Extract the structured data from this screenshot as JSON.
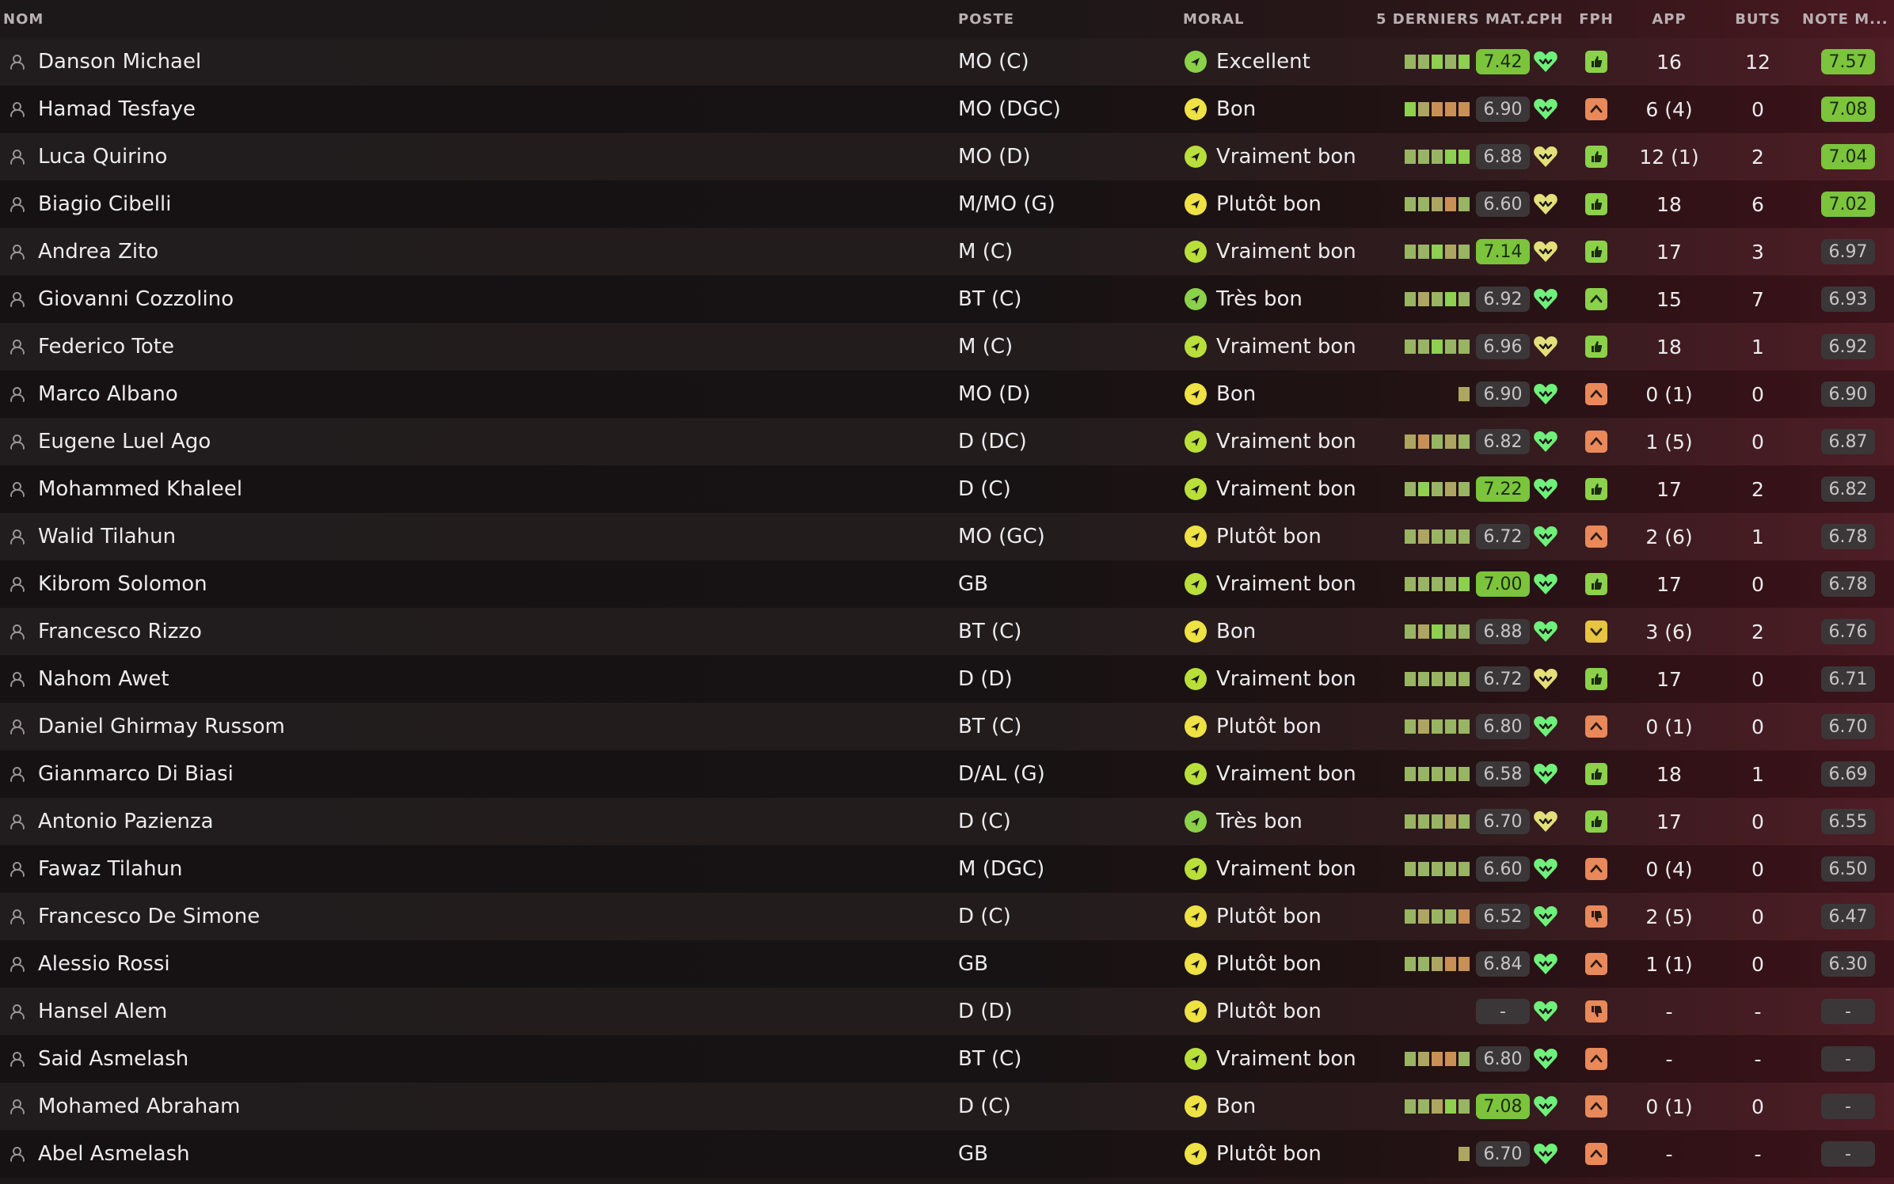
{
  "headers": {
    "nom": "NOM",
    "poste": "POSTE",
    "moral": "MORAL",
    "forme": "5 DERNIERS MAT...",
    "cph": "CPH",
    "fph": "FPH",
    "app": "APP",
    "buts": "BUTS",
    "note": "NOTE M..."
  },
  "icons": {
    "player": "person-icon",
    "cph": "heart-icon",
    "fph_up": "chevron-up-icon",
    "fph_down": "chevron-down-icon",
    "fph_thumb": "thumb-up-icon",
    "fph_thumbdown": "thumb-down-icon",
    "morale": "arrow-icon"
  },
  "colors": {
    "green": "#8bd14a",
    "lime": "#b9df3a",
    "yellow": "#eee244",
    "orange": "#e9895a",
    "heart_green": "#6ef07a",
    "heart_yellow": "#e3e07a"
  },
  "players": [
    {
      "name": "Danson Michael",
      "pos": "MO (C)",
      "moral": "Excellent",
      "mood": "green",
      "bars": [
        "t",
        "t",
        "g",
        "t",
        "g"
      ],
      "form": "7.42",
      "formStyle": "hi",
      "cph": "green",
      "fph": "thumb",
      "app": "16",
      "buts": "12",
      "note": "7.57",
      "noteStyle": "hi"
    },
    {
      "name": "Hamad Tesfaye",
      "pos": "MO (DGC)",
      "moral": "Bon",
      "mood": "yellow",
      "bars": [
        "g",
        "o",
        "r",
        "r",
        "r"
      ],
      "form": "6.90",
      "formStyle": "mute",
      "cph": "green",
      "fph": "up",
      "app": "6 (4)",
      "buts": "0",
      "note": "7.08",
      "noteStyle": "hi"
    },
    {
      "name": "Luca Quirino",
      "pos": "MO (D)",
      "moral": "Vraiment bon",
      "mood": "lime",
      "bars": [
        "t",
        "t",
        "t",
        "g",
        "g"
      ],
      "form": "6.88",
      "formStyle": "mute",
      "cph": "yellow",
      "fph": "thumb",
      "app": "12 (1)",
      "buts": "2",
      "note": "7.04",
      "noteStyle": "hi"
    },
    {
      "name": "Biagio Cibelli",
      "pos": "M/MO (G)",
      "moral": "Plutôt bon",
      "mood": "yellow",
      "bars": [
        "t",
        "t",
        "o",
        "r",
        "t"
      ],
      "form": "6.60",
      "formStyle": "mute",
      "cph": "yellow",
      "fph": "thumb",
      "app": "18",
      "buts": "6",
      "note": "7.02",
      "noteStyle": "hi"
    },
    {
      "name": "Andrea Zito",
      "pos": "M (C)",
      "moral": "Vraiment bon",
      "mood": "lime",
      "bars": [
        "t",
        "t",
        "g",
        "o",
        "t"
      ],
      "form": "7.14",
      "formStyle": "hi",
      "cph": "yellow",
      "fph": "thumb",
      "app": "17",
      "buts": "3",
      "note": "6.97",
      "noteStyle": "mute"
    },
    {
      "name": "Giovanni Cozzolino",
      "pos": "BT (C)",
      "moral": "Très bon",
      "mood": "green",
      "bars": [
        "t",
        "o",
        "t",
        "g",
        "t"
      ],
      "form": "6.92",
      "formStyle": "mute",
      "cph": "green",
      "fph": "upgreen",
      "app": "15",
      "buts": "7",
      "note": "6.93",
      "noteStyle": "mute"
    },
    {
      "name": "Federico Tote",
      "pos": "M (C)",
      "moral": "Vraiment bon",
      "mood": "lime",
      "bars": [
        "t",
        "t",
        "g",
        "t",
        "t"
      ],
      "form": "6.96",
      "formStyle": "mute",
      "cph": "yellow",
      "fph": "thumb",
      "app": "18",
      "buts": "1",
      "note": "6.92",
      "noteStyle": "mute"
    },
    {
      "name": "Marco Albano",
      "pos": "MO (D)",
      "moral": "Bon",
      "mood": "yellow",
      "bars": [
        "o"
      ],
      "form": "6.90",
      "formStyle": "mute",
      "cph": "green",
      "fph": "up",
      "app": "0 (1)",
      "buts": "0",
      "note": "6.90",
      "noteStyle": "mute"
    },
    {
      "name": "Eugene Luel Ago",
      "pos": "D (DC)",
      "moral": "Vraiment bon",
      "mood": "lime",
      "bars": [
        "o",
        "r",
        "t",
        "o",
        "t"
      ],
      "form": "6.82",
      "formStyle": "mute",
      "cph": "green",
      "fph": "up",
      "app": "1 (5)",
      "buts": "0",
      "note": "6.87",
      "noteStyle": "mute"
    },
    {
      "name": "Mohammed Khaleel",
      "pos": "D (C)",
      "moral": "Vraiment bon",
      "mood": "lime",
      "bars": [
        "t",
        "g",
        "t",
        "o",
        "t"
      ],
      "form": "7.22",
      "formStyle": "hi",
      "cph": "green",
      "fph": "thumb",
      "app": "17",
      "buts": "2",
      "note": "6.82",
      "noteStyle": "mute"
    },
    {
      "name": "Walid Tilahun",
      "pos": "MO (GC)",
      "moral": "Plutôt bon",
      "mood": "yellow",
      "bars": [
        "t",
        "o",
        "t",
        "t",
        "t"
      ],
      "form": "6.72",
      "formStyle": "mute",
      "cph": "green",
      "fph": "up",
      "app": "2 (6)",
      "buts": "1",
      "note": "6.78",
      "noteStyle": "mute"
    },
    {
      "name": "Kibrom Solomon",
      "pos": "GB",
      "moral": "Vraiment bon",
      "mood": "lime",
      "bars": [
        "t",
        "t",
        "t",
        "t",
        "g"
      ],
      "form": "7.00",
      "formStyle": "hi",
      "cph": "green",
      "fph": "thumb",
      "app": "17",
      "buts": "0",
      "note": "6.78",
      "noteStyle": "mute"
    },
    {
      "name": "Francesco Rizzo",
      "pos": "BT (C)",
      "moral": "Bon",
      "mood": "yellow",
      "bars": [
        "t",
        "o",
        "g",
        "t",
        "t"
      ],
      "form": "6.88",
      "formStyle": "mute",
      "cph": "green",
      "fph": "down",
      "app": "3 (6)",
      "buts": "2",
      "note": "6.76",
      "noteStyle": "mute"
    },
    {
      "name": "Nahom Awet",
      "pos": "D (D)",
      "moral": "Vraiment bon",
      "mood": "lime",
      "bars": [
        "t",
        "t",
        "t",
        "t",
        "t"
      ],
      "form": "6.72",
      "formStyle": "mute",
      "cph": "yellow",
      "fph": "thumb",
      "app": "17",
      "buts": "0",
      "note": "6.71",
      "noteStyle": "mute"
    },
    {
      "name": "Daniel Ghirmay Russom",
      "pos": "BT (C)",
      "moral": "Plutôt bon",
      "mood": "yellow",
      "bars": [
        "t",
        "o",
        "t",
        "t",
        "t"
      ],
      "form": "6.80",
      "formStyle": "mute",
      "cph": "green",
      "fph": "up",
      "app": "0 (1)",
      "buts": "0",
      "note": "6.70",
      "noteStyle": "mute"
    },
    {
      "name": "Gianmarco Di Biasi",
      "pos": "D/AL (G)",
      "moral": "Vraiment bon",
      "mood": "lime",
      "bars": [
        "t",
        "t",
        "t",
        "t",
        "t"
      ],
      "form": "6.58",
      "formStyle": "mute",
      "cph": "green",
      "fph": "thumb",
      "app": "18",
      "buts": "1",
      "note": "6.69",
      "noteStyle": "mute"
    },
    {
      "name": "Antonio Pazienza",
      "pos": "D (C)",
      "moral": "Très bon",
      "mood": "green",
      "bars": [
        "t",
        "t",
        "t",
        "o",
        "t"
      ],
      "form": "6.70",
      "formStyle": "mute",
      "cph": "yellow",
      "fph": "thumb",
      "app": "17",
      "buts": "0",
      "note": "6.55",
      "noteStyle": "mute"
    },
    {
      "name": "Fawaz Tilahun",
      "pos": "M (DGC)",
      "moral": "Vraiment bon",
      "mood": "lime",
      "bars": [
        "t",
        "t",
        "t",
        "t",
        "t"
      ],
      "form": "6.60",
      "formStyle": "mute",
      "cph": "green",
      "fph": "up",
      "app": "0 (4)",
      "buts": "0",
      "note": "6.50",
      "noteStyle": "mute"
    },
    {
      "name": "Francesco De Simone",
      "pos": "D (C)",
      "moral": "Plutôt bon",
      "mood": "yellow",
      "bars": [
        "t",
        "o",
        "t",
        "t",
        "r"
      ],
      "form": "6.52",
      "formStyle": "mute",
      "cph": "green",
      "fph": "thumbdown",
      "app": "2 (5)",
      "buts": "0",
      "note": "6.47",
      "noteStyle": "mute"
    },
    {
      "name": "Alessio Rossi",
      "pos": "GB",
      "moral": "Plutôt bon",
      "mood": "yellow",
      "bars": [
        "t",
        "t",
        "o",
        "r",
        "r"
      ],
      "form": "6.84",
      "formStyle": "mute",
      "cph": "green",
      "fph": "up",
      "app": "1 (1)",
      "buts": "0",
      "note": "6.30",
      "noteStyle": "mute"
    },
    {
      "name": "Hansel Alem",
      "pos": "D (D)",
      "moral": "Plutôt bon",
      "mood": "yellow",
      "bars": [],
      "form": "-",
      "formStyle": "mute",
      "cph": "green",
      "fph": "thumbdown",
      "app": "-",
      "buts": "-",
      "note": "-",
      "noteStyle": "mute"
    },
    {
      "name": "Said Asmelash",
      "pos": "BT (C)",
      "moral": "Vraiment bon",
      "mood": "lime",
      "bars": [
        "t",
        "o",
        "r",
        "r",
        "t"
      ],
      "form": "6.80",
      "formStyle": "mute",
      "cph": "green",
      "fph": "up",
      "app": "-",
      "buts": "-",
      "note": "-",
      "noteStyle": "mute"
    },
    {
      "name": "Mohamed Abraham",
      "pos": "D (C)",
      "moral": "Bon",
      "mood": "yellow",
      "bars": [
        "t",
        "t",
        "o",
        "g",
        "t"
      ],
      "form": "7.08",
      "formStyle": "hi",
      "cph": "green",
      "fph": "up",
      "app": "0 (1)",
      "buts": "0",
      "note": "-",
      "noteStyle": "mute"
    },
    {
      "name": "Abel Asmelash",
      "pos": "GB",
      "moral": "Plutôt bon",
      "mood": "yellow",
      "bars": [
        "o"
      ],
      "form": "6.70",
      "formStyle": "mute",
      "cph": "green",
      "fph": "up",
      "app": "-",
      "buts": "-",
      "note": "-",
      "noteStyle": "mute"
    }
  ]
}
